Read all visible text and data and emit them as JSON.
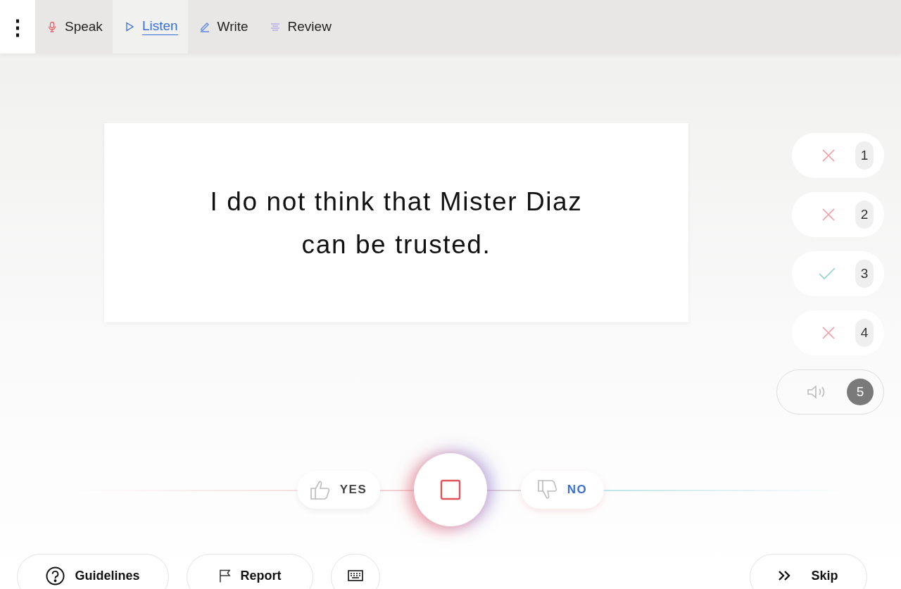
{
  "menu_button": {
    "label": "⋮"
  },
  "tabs": [
    {
      "label": "Speak",
      "selected": false
    },
    {
      "label": "Listen",
      "selected": true
    },
    {
      "label": "Write",
      "selected": false
    },
    {
      "label": "Review",
      "selected": false
    }
  ],
  "sentence": "I do not think that Mister Diaz can be trusted.",
  "clips": [
    {
      "label": "1",
      "kind": "rejected",
      "selected": false
    },
    {
      "label": "2",
      "kind": "rejected",
      "selected": false
    },
    {
      "label": "3",
      "kind": "approved",
      "selected": false
    },
    {
      "label": "4",
      "kind": "rejected",
      "selected": false
    },
    {
      "label": "5",
      "kind": "pending",
      "selected": true
    }
  ],
  "vote": {
    "yes": "YES",
    "no": "NO"
  },
  "footer": {
    "guidelines": "Guidelines",
    "report": "Report",
    "skip": "Skip"
  }
}
